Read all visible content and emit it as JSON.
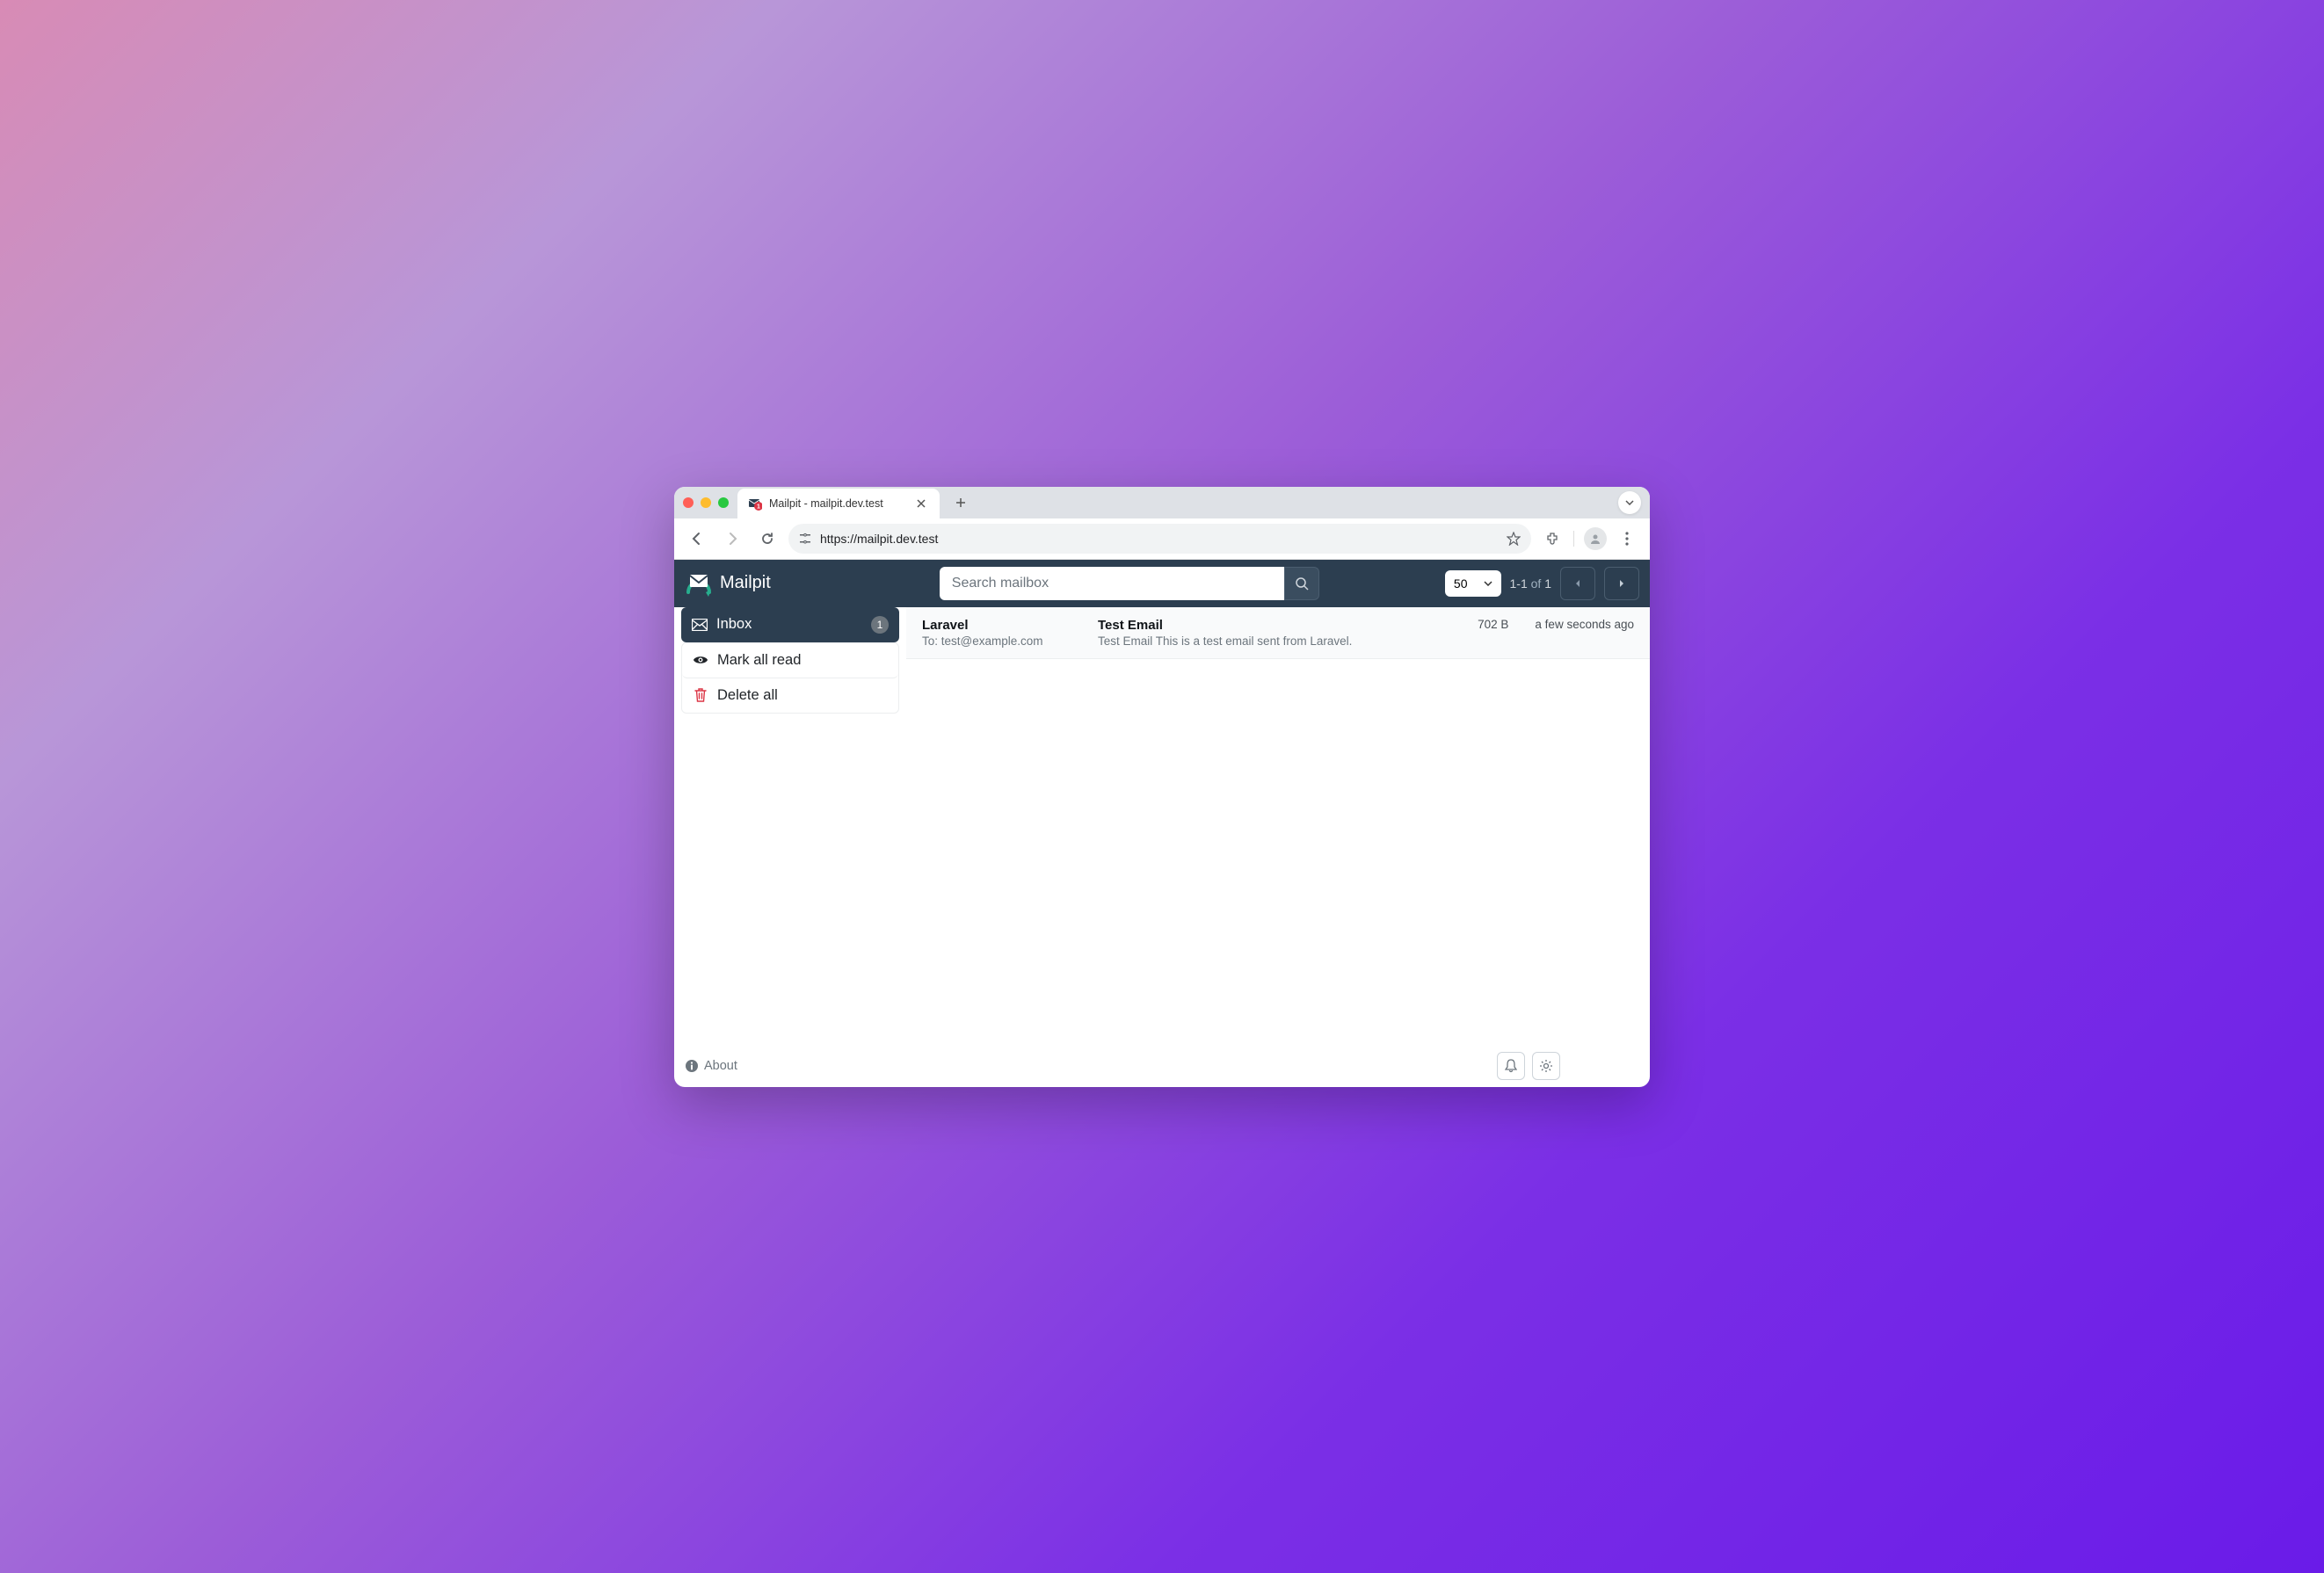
{
  "browser": {
    "tab_title": "Mailpit - mailpit.dev.test",
    "url": "https://mailpit.dev.test"
  },
  "app": {
    "brand": "Mailpit",
    "search_placeholder": "Search mailbox",
    "page_size": "50",
    "pagination_range": "1-1",
    "pagination_of": "of",
    "pagination_total": "1"
  },
  "sidebar": {
    "inbox_label": "Inbox",
    "inbox_count": "1",
    "mark_read_label": "Mark all read",
    "delete_all_label": "Delete all",
    "about_label": "About"
  },
  "messages": [
    {
      "from": "Laravel",
      "to_line": "To: test@example.com",
      "subject": "Test Email",
      "preview": "Test Email This is a test email sent from Laravel.",
      "size": "702 B",
      "time": "a few seconds ago"
    }
  ]
}
